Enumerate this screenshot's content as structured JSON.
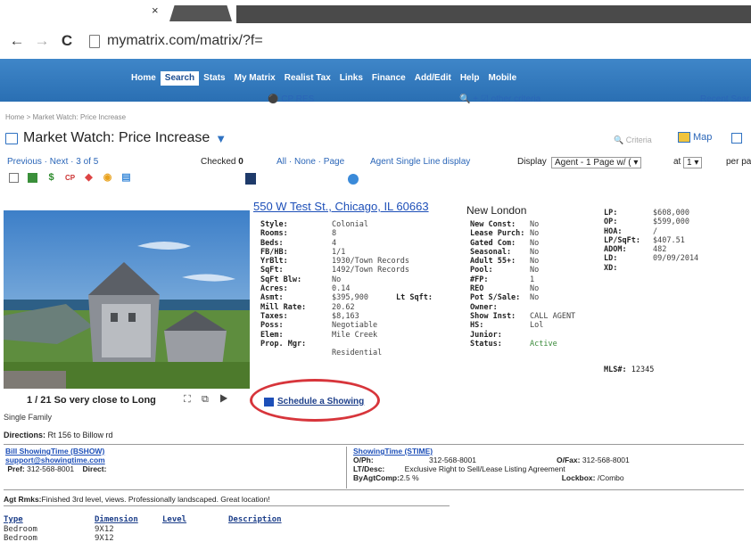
{
  "browser": {
    "tab_close": "×",
    "url": "mymatrix.com/matrix/?f=",
    "back_glyph": "←",
    "forward_glyph": "→",
    "reload_glyph": "C"
  },
  "menu": {
    "items": [
      "Home",
      "Search",
      "Stats",
      "My Matrix",
      "Realist Tax",
      "Links",
      "Finance",
      "Add/Edit",
      "Help",
      "Mobile"
    ],
    "active": "Search"
  },
  "subbar": {
    "cp": "CP RES",
    "other": "+ ☑ other criteria",
    "recent": "Recent Sear"
  },
  "breadcrumb": "Home > Market Watch: Price Increase",
  "page_title": "Market Watch: Price Increase",
  "toolbar": {
    "criteria": "Criteria",
    "map": "Map",
    "prev_next": "Previous · Next · 3 of 5",
    "checked_label": "Checked",
    "checked_count": "0",
    "select_links": "All · None · Page",
    "agent_line": "Agent Single Line display",
    "display_label": "Display",
    "display_value": "Agent - 1 Page w/ ( ▾",
    "at_label": "at",
    "at_value": "1       ▾",
    "per_page": "per pa"
  },
  "listing": {
    "address": "550 W Test St., Chicago, IL 60663",
    "area": "New London",
    "photo_caption": "1 / 21  So very close to Long",
    "property_type": "Single Family",
    "directions_label": "Directions:",
    "directions": "Rt 156 to Billow rd",
    "col1": [
      {
        "k": "Style:",
        "v": "Colonial"
      },
      {
        "k": "Rooms:",
        "v": "8"
      },
      {
        "k": "Beds:",
        "v": "4"
      },
      {
        "k": "FB/HB:",
        "v": "1/1"
      },
      {
        "k": "YrBlt:",
        "v": "1930/Town Records"
      },
      {
        "k": "SqFt:",
        "v": "1492/Town Records"
      },
      {
        "k": "SqFt Blw:",
        "v": "No"
      },
      {
        "k": "Acres:",
        "v": "0.14"
      },
      {
        "k": "Asmt:",
        "v": "$395,900"
      },
      {
        "k": "Mill Rate:",
        "v": "20.62"
      },
      {
        "k": "Taxes:",
        "v": "$8,163"
      },
      {
        "k": "Poss:",
        "v": "Negotiable"
      },
      {
        "k": "Elem:",
        "v": "Mile Creek"
      },
      {
        "k": "Prop. Mgr:",
        "v": ""
      },
      {
        "k": "",
        "v": "Residential"
      }
    ],
    "lt_sqft": "Lt Sqft:",
    "col2": [
      {
        "k": "New Const:",
        "v": "No"
      },
      {
        "k": "Lease Purch:",
        "v": "No"
      },
      {
        "k": "Gated Com:",
        "v": "No"
      },
      {
        "k": "Seasonal:",
        "v": "No"
      },
      {
        "k": "Adult 55+:",
        "v": "No"
      },
      {
        "k": "Pool:",
        "v": "No"
      },
      {
        "k": "#FP:",
        "v": "1"
      },
      {
        "k": "REO",
        "v": "No"
      },
      {
        "k": "Pot S/Sale:",
        "v": "No"
      },
      {
        "k": "Owner:",
        "v": ""
      },
      {
        "k": "Show Inst:",
        "v": "CALL AGENT"
      },
      {
        "k": "",
        "v": ""
      },
      {
        "k": "HS:",
        "v": "Lol"
      },
      {
        "k": "Junior:",
        "v": ""
      },
      {
        "k": "Status:",
        "v": "Active"
      }
    ],
    "col3": [
      {
        "k": "LP:",
        "v": "$608,000"
      },
      {
        "k": "",
        "v": ""
      },
      {
        "k": "OP:",
        "v": "$599,000"
      },
      {
        "k": "HOA:",
        "v": "/"
      },
      {
        "k": "LP/SqFt:",
        "v": "$407.51"
      },
      {
        "k": "ADOM:",
        "v": "482"
      },
      {
        "k": "LD:",
        "v": "09/09/2014"
      },
      {
        "k": "XD:",
        "v": ""
      }
    ],
    "mls_label": "MLS#:",
    "mls": "12345",
    "schedule": "Schedule a Showing"
  },
  "contact": {
    "agent": "Bill ShowingTime (BSHOW)",
    "email": "support@showingtime.com",
    "pref_label": "Pref:",
    "pref": "312-568-8001",
    "direct_label": "Direct:",
    "office": "ShowingTime (STIME)",
    "oph_label": "O/Ph:",
    "oph": "312-568-8001",
    "ofax_label": "O/Fax:",
    "ofax": "312-568-8001",
    "ltdesc_label": "LT/Desc:",
    "ltdesc": "Exclusive Right to Sell/Lease Listing Agreement",
    "byagt_label": "ByAgtComp:",
    "byagt": "2.5 %",
    "lockbox_label": "Lockbox:",
    "lockbox": "/Combo"
  },
  "remarks": {
    "label": "Agt Rmks:",
    "text": "Finished 3rd level, views. Professionally landscaped. Great location!"
  },
  "rooms": {
    "headers": [
      "Type",
      "Dimension",
      "Level",
      "Description"
    ],
    "rows": [
      {
        "type": "Bedroom",
        "dim": "9X12"
      },
      {
        "type": "Bedroom",
        "dim": "9X12"
      }
    ]
  },
  "colors": {
    "banner": "#2a6fb3",
    "link": "#1d4fb8",
    "highlight_circle": "#d7353b"
  }
}
